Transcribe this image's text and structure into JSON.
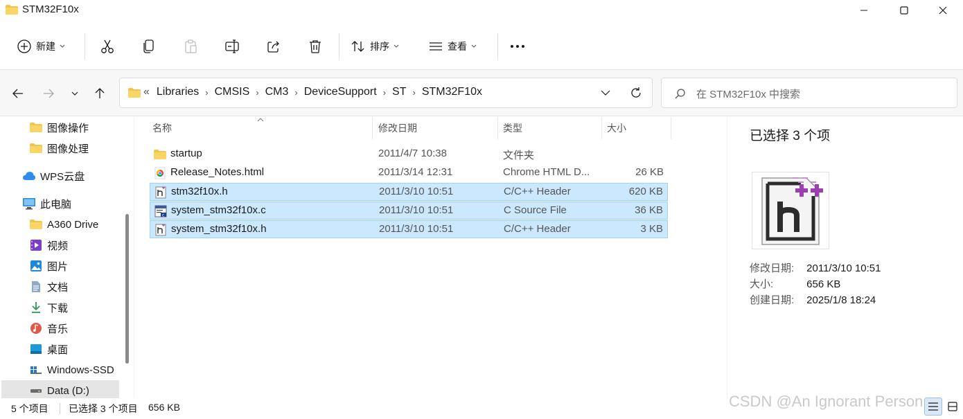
{
  "window": {
    "title": "STM32F10x"
  },
  "toolbar": {
    "new_label": "新建",
    "sort_label": "排序",
    "view_label": "查看",
    "more_label": "···"
  },
  "address": {
    "overflow": "«",
    "crumbs": [
      "Libraries",
      "CMSIS",
      "CM3",
      "DeviceSupport",
      "ST",
      "STM32F10x"
    ],
    "search_placeholder": "在 STM32F10x 中搜索"
  },
  "sidebar": {
    "items": [
      {
        "label": "图像操作",
        "icon": "folder-icon"
      },
      {
        "label": "图像处理",
        "icon": "folder-icon"
      },
      {
        "label": "WPS云盘",
        "icon": "cloud-icon"
      },
      {
        "label": "此电脑",
        "icon": "computer-icon"
      },
      {
        "label": "A360 Drive",
        "icon": "folder-icon"
      },
      {
        "label": "视频",
        "icon": "video-icon"
      },
      {
        "label": "图片",
        "icon": "pictures-icon"
      },
      {
        "label": "文档",
        "icon": "documents-icon"
      },
      {
        "label": "下载",
        "icon": "download-icon"
      },
      {
        "label": "音乐",
        "icon": "music-icon"
      },
      {
        "label": "桌面",
        "icon": "desktop-icon"
      },
      {
        "label": "Windows-SSD",
        "icon": "drive-icon"
      },
      {
        "label": "Data (D:)",
        "icon": "drive-icon"
      }
    ]
  },
  "columns": {
    "name": "名称",
    "date": "修改日期",
    "type": "类型",
    "size": "大小"
  },
  "files": [
    {
      "name": "startup",
      "date": "2011/4/7 10:38",
      "type": "文件夹",
      "size": "",
      "icon": "folder-icon",
      "selected": false
    },
    {
      "name": "Release_Notes.html",
      "date": "2011/3/14 12:31",
      "type": "Chrome HTML D...",
      "size": "26 KB",
      "icon": "chrome-icon",
      "selected": false
    },
    {
      "name": "stm32f10x.h",
      "date": "2011/3/10 10:51",
      "type": "C/C++ Header",
      "size": "620 KB",
      "icon": "header-file-icon",
      "selected": true
    },
    {
      "name": "system_stm32f10x.c",
      "date": "2011/3/10 10:51",
      "type": "C Source File",
      "size": "36 KB",
      "icon": "c-source-icon",
      "selected": true
    },
    {
      "name": "system_stm32f10x.h",
      "date": "2011/3/10 10:51",
      "type": "C/C++ Header",
      "size": "3 KB",
      "icon": "header-file-icon",
      "selected": true
    }
  ],
  "details": {
    "title": "已选择 3 个项",
    "modified_key": "修改日期:",
    "modified_val": "2011/3/10 10:51",
    "size_key": "大小:",
    "size_val": "656 KB",
    "created_key": "创建日期:",
    "created_val": "2025/1/8 18:24"
  },
  "status": {
    "count": "5 个项目",
    "selected": "已选择 3 个项目",
    "selected_size": "656 KB"
  },
  "watermark": "CSDN @An Ignorant Person",
  "colors": {
    "selection_bg": "#cce8ff",
    "selection_border": "#99d1ff",
    "folder": "#f3c44a",
    "header_badge": "#9b3fb1"
  }
}
